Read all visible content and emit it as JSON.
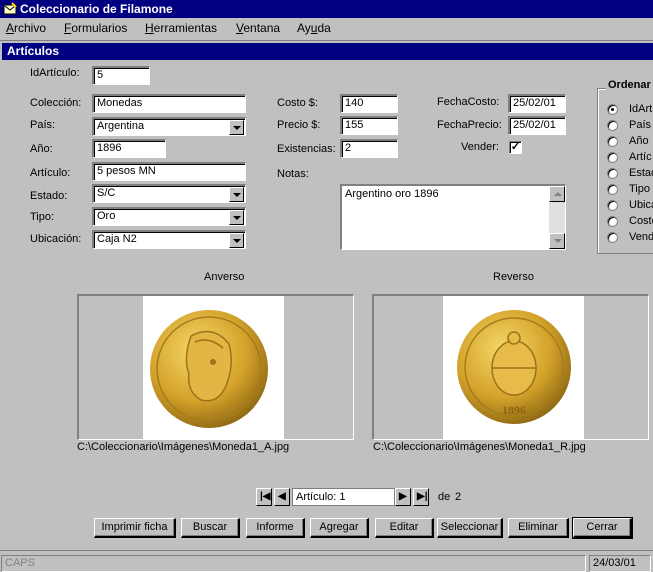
{
  "window": {
    "title": "Coleccionario de  Filamone"
  },
  "menu": [
    {
      "label": "Archivo",
      "accel": "A"
    },
    {
      "label": "Formularios",
      "accel": "F"
    },
    {
      "label": "Herramientas",
      "accel": "H"
    },
    {
      "label": "Ventana",
      "accel": "V"
    },
    {
      "label": "Ayuda",
      "accel": "u"
    }
  ],
  "child": {
    "title": "Artículos"
  },
  "fields": {
    "id_label": "IdArtículo:",
    "id_value": "5",
    "coleccion_label": "Colección:",
    "coleccion_value": "Monedas",
    "pais_label": "País:",
    "pais_value": "Argentina",
    "anio_label": "Año:",
    "anio_value": "1896",
    "articulo_label": "Artículo:",
    "articulo_value": "5 pesos MN",
    "estado_label": "Estado:",
    "estado_value": "S/C",
    "tipo_label": "Tipo:",
    "tipo_value": "Oro",
    "ubicacion_label": "Ubicación:",
    "ubicacion_value": "Caja N2",
    "costo_label": "Costo $:",
    "costo_value": "140",
    "precio_label": "Precio $:",
    "precio_value": "155",
    "existencias_label": "Existencias:",
    "existencias_value": "2",
    "notas_label": "Notas:",
    "notas_value": "Argentino oro 1896",
    "fechacosto_label": "FechaCosto:",
    "fechacosto_value": "25/02/01",
    "fechaprecio_label": "FechaPrecio:",
    "fechaprecio_value": "25/02/01",
    "vender_label": "Vender:",
    "vender_checked": true,
    "vender_mark": "✓"
  },
  "ordenar": {
    "title": "Ordenar",
    "options": [
      "IdArt",
      "País",
      "Año",
      "Artíc",
      "Estad",
      "Tipo",
      "Ubica",
      "Costo",
      "Vend"
    ],
    "selected_index": 0
  },
  "images": {
    "anverso_label": "Anverso",
    "reverso_label": "Reverso",
    "anverso_path": "C:\\Coleccionario\\Imágenes\\Moneda1_A.jpg",
    "reverso_path": "C:\\Coleccionario\\Imágenes\\Moneda1_R.jpg",
    "reverso_year": "1896"
  },
  "navigation": {
    "record_text": "Artículo: 1",
    "of_label": "de",
    "total": "2"
  },
  "buttons": {
    "imprimir": "Imprimir ficha",
    "buscar": "Buscar",
    "informe": "Informe",
    "agregar": "Agregar",
    "editar": "Editar",
    "seleccionar": "Seleccionar",
    "eliminar": "Eliminar",
    "cerrar": "Cerrar"
  },
  "status": {
    "caps": "CAPS",
    "date": "24/03/01"
  },
  "colors": {
    "titlebar": "#000080",
    "face": "#c0c0c0",
    "gold": "#d4a22a"
  }
}
